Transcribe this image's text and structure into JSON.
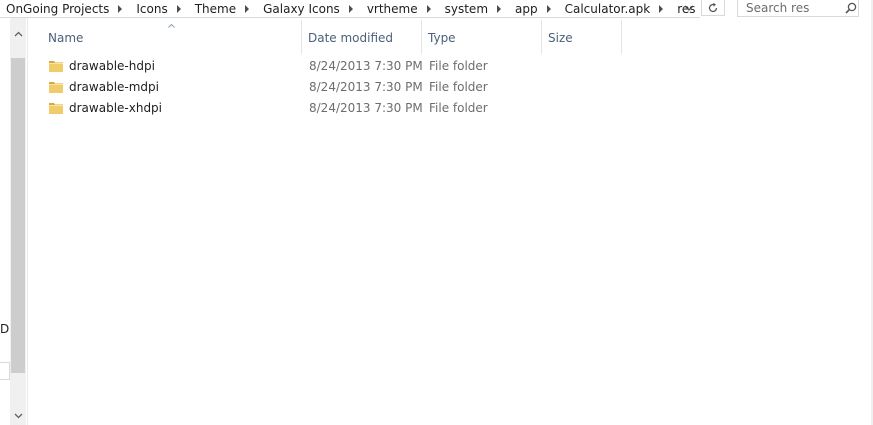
{
  "address": {
    "crumbs": [
      "OnGoing Projects",
      "Icons",
      "Theme",
      "Galaxy Icons",
      "vrtheme",
      "system",
      "app",
      "Calculator.apk",
      "res"
    ]
  },
  "search": {
    "placeholder": "Search res"
  },
  "columns": {
    "name": "Name",
    "date_modified": "Date modified",
    "type": "Type",
    "size": "Size",
    "sort_column": "Name",
    "sort_direction": "ascending"
  },
  "files": [
    {
      "name": "drawable-hdpi",
      "date": "8/24/2013 7:30 PM",
      "type": "File folder"
    },
    {
      "name": "drawable-mdpi",
      "date": "8/24/2013 7:30 PM",
      "type": "File folder"
    },
    {
      "name": "drawable-xhdpi",
      "date": "8/24/2013 7:30 PM",
      "type": "File folder"
    }
  ],
  "navpane": {
    "fragment": "D"
  },
  "icons": {
    "folder": "folder-icon",
    "refresh": "refresh-icon",
    "search": "search-icon",
    "dropdown": "chevron-down-icon",
    "sort": "sort-ascending-icon"
  },
  "colors": {
    "header_text": "#4c607a",
    "secondary_text": "#6d6d6d",
    "folder_yellow": "#e8c05a"
  }
}
